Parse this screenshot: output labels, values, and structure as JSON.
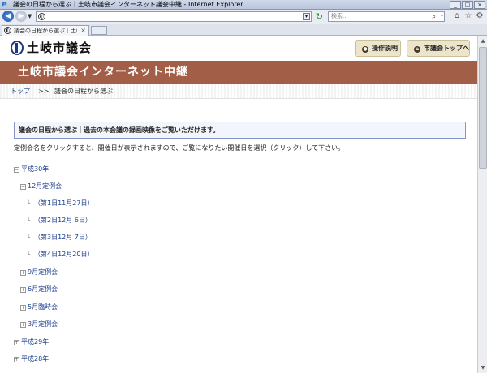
{
  "browser": {
    "window_title": "議会の日程から選ぶ｜土岐市議会インターネット議会中継 - Internet Explorer",
    "search_placeholder": "検索...",
    "tab_label": "議会の日程から選ぶ｜土岐...",
    "window_buttons": [
      "_",
      "□",
      "×"
    ]
  },
  "site": {
    "logo_text": "土岐市議会",
    "help_button": "操作説明",
    "top_button": "市議会トップへ",
    "banner_title": "土岐市議会インターネット中継"
  },
  "breadcrumb": {
    "home": "トップ",
    "separator": ">>",
    "current": "議会の日程から選ぶ"
  },
  "main": {
    "info_text": "議会の日程から選ぶ｜過去の本会議の録画映像をご覧いただけます。",
    "instruction": "定例会名をクリックすると、開催日が表示されますので、ご覧になりたい開催日を選択（クリック）して下さい。"
  },
  "tree": {
    "year_2018": "平成30年",
    "session_dec": "12月定例会",
    "days_dec": [
      "（第1日11月27日）",
      "（第2日12月 6日）",
      "（第3日12月 7日）",
      "（第4日12月20日）"
    ],
    "session_sep": "9月定例会",
    "session_jun": "6月定例会",
    "session_may": "5月臨時会",
    "session_mar": "3月定例会",
    "year_2017": "平成29年",
    "year_2016": "平成28年"
  },
  "colors": {
    "banner": "#a35e48",
    "link": "#1a3c8c",
    "button_bg": "#ece5cc"
  }
}
